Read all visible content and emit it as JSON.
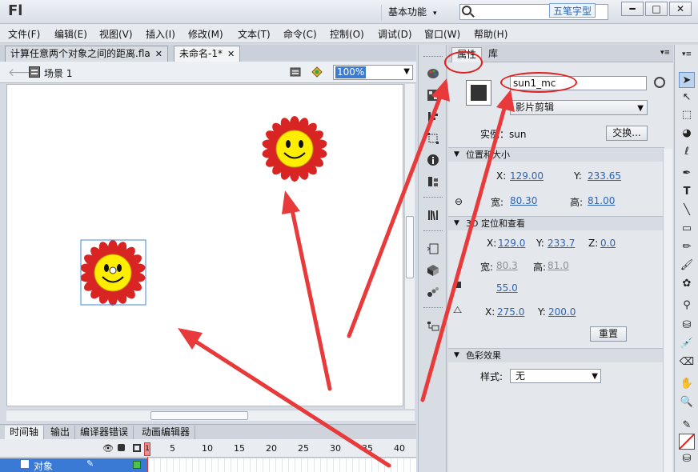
{
  "app": {
    "logo": "Fl",
    "workspace": "基本功能",
    "ime_label": "五笔字型"
  },
  "window_buttons": {
    "minimize": "━",
    "maximize": "□",
    "close": "✕"
  },
  "menu": [
    "文件(F)",
    "编辑(E)",
    "视图(V)",
    "插入(I)",
    "修改(M)",
    "文本(T)",
    "命令(C)",
    "控制(O)",
    "调试(D)",
    "窗口(W)",
    "帮助(H)"
  ],
  "tabs": [
    {
      "label": "计算任意两个对象之间的距离.fla",
      "close": "✕"
    },
    {
      "label": "未命名-1*",
      "close": "✕"
    }
  ],
  "editbar": {
    "scene": "场景 1",
    "zoom": "100%"
  },
  "timeline": {
    "tabs": [
      "时间轴",
      "输出",
      "编译器错误",
      "动画编辑器"
    ],
    "frame_numbers": [
      "1",
      "5",
      "10",
      "15",
      "20",
      "25",
      "30",
      "35",
      "40"
    ],
    "layer_name": "对象"
  },
  "properties": {
    "tabs": [
      "属性",
      "库"
    ],
    "instance_name": "sun1_mc",
    "symbol_type": "影片剪辑",
    "instance_label": "实例：sun",
    "swap_button": "交换...",
    "pos_size": {
      "title": "位置和大小",
      "x_label": "X:",
      "x": "129.00",
      "y_label": "Y:",
      "y": "233.65",
      "w_label": "宽:",
      "w": "80.30",
      "h_label": "高:",
      "h": "81.00"
    },
    "three_d": {
      "title": "3D 定位和查看",
      "x_label": "X:",
      "x": "129.0",
      "y_label": "Y:",
      "y": "233.7",
      "z_label": "Z:",
      "z": "0.0",
      "w_label": "宽:",
      "w": "80.3",
      "h_label": "高:",
      "h": "81.0",
      "perspective": "55.0",
      "vp_x_label": "X:",
      "vp_x": "275.0",
      "vp_y_label": "Y:",
      "vp_y": "200.0",
      "reset_button": "重置"
    },
    "color_effect": {
      "title": "色彩效果",
      "style_label": "样式:",
      "style_value": "无"
    }
  },
  "colors": {
    "annotation_red": "#e02020",
    "sun_petal": "#d92424",
    "sun_face": "#ffee00",
    "layer_selected": "#3a79d4",
    "value_link": "#2e64b3"
  }
}
